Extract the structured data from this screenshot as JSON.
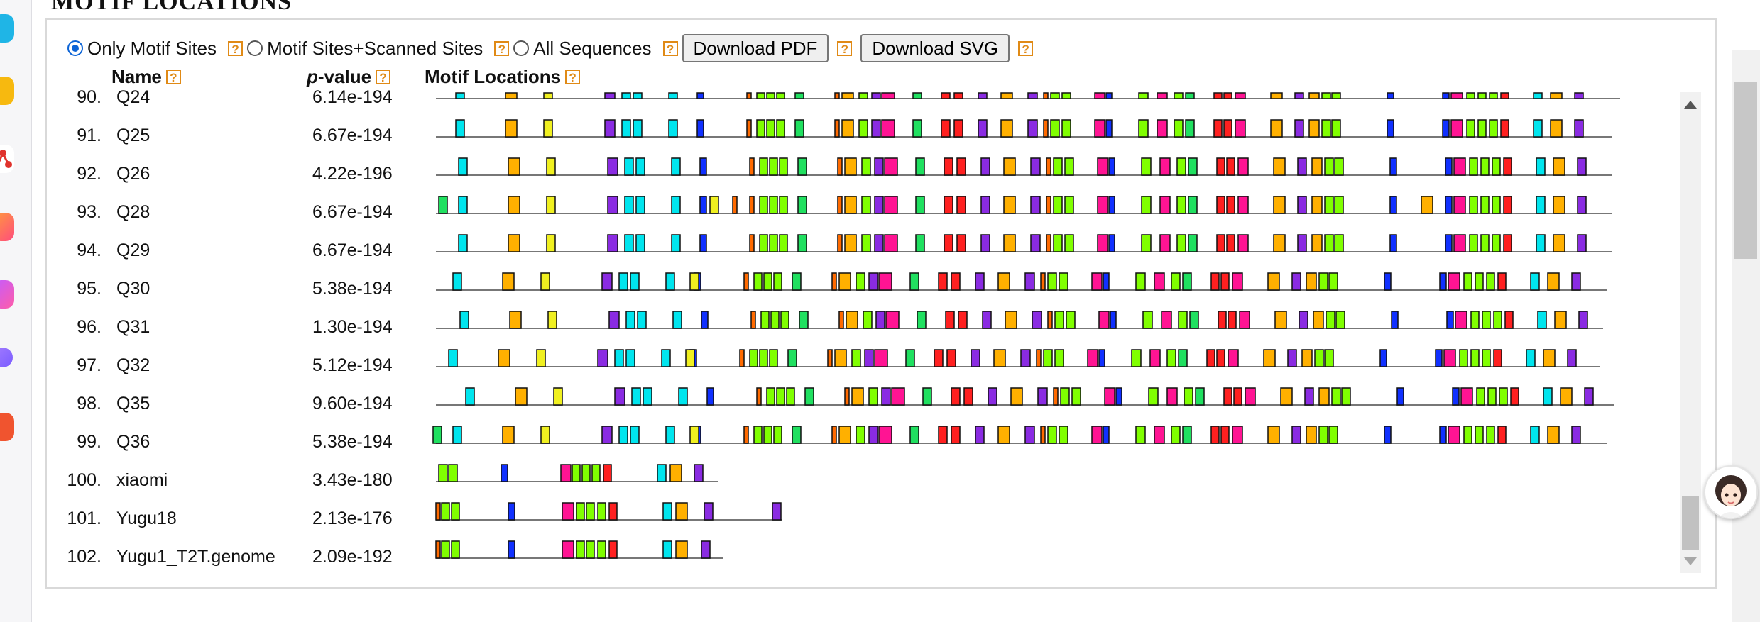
{
  "section": {
    "title": "MOTIF LOCATIONS"
  },
  "toolbar": {
    "options": [
      {
        "label": "Only Motif Sites",
        "selected": true
      },
      {
        "label": "Motif Sites+Scanned Sites",
        "selected": false
      },
      {
        "label": "All Sequences",
        "selected": false
      }
    ],
    "download_pdf": "Download PDF",
    "download_svg": "Download SVG",
    "help_glyph": "?"
  },
  "columns": {
    "name": "Name",
    "pvalue_p": "p",
    "pvalue_rest": "-value",
    "locations": "Motif Locations"
  },
  "rows": [
    {
      "num": "90.",
      "name": "Q24",
      "pvalue": "6.14e-194"
    },
    {
      "num": "91.",
      "name": "Q25",
      "pvalue": "6.67e-194"
    },
    {
      "num": "92.",
      "name": "Q26",
      "pvalue": "4.22e-196"
    },
    {
      "num": "93.",
      "name": "Q28",
      "pvalue": "6.67e-194"
    },
    {
      "num": "94.",
      "name": "Q29",
      "pvalue": "6.67e-194"
    },
    {
      "num": "95.",
      "name": "Q30",
      "pvalue": "5.38e-194"
    },
    {
      "num": "96.",
      "name": "Q31",
      "pvalue": "1.30e-194"
    },
    {
      "num": "97.",
      "name": "Q32",
      "pvalue": "5.12e-194"
    },
    {
      "num": "98.",
      "name": "Q35",
      "pvalue": "9.60e-194"
    },
    {
      "num": "99.",
      "name": "Q36",
      "pvalue": "5.38e-194"
    },
    {
      "num": "100.",
      "name": "xiaomi",
      "pvalue": "3.43e-180"
    },
    {
      "num": "101.",
      "name": "Yugu18",
      "pvalue": "2.13e-176"
    },
    {
      "num": "102.",
      "name": "Yugu1_T2T.genome",
      "pvalue": "2.09e-192"
    }
  ],
  "colors": {
    "help_orange": "#e08a16",
    "radio_blue": "#0b63d6",
    "motif_palette": [
      "#00e5ee",
      "#ffb000",
      "#f0f020",
      "#8a2be2",
      "#1030ff",
      "#ff1493",
      "#80ff00",
      "#ff2020",
      "#ff6a00",
      "#20e060"
    ]
  },
  "icons": [
    "radio-icon",
    "help-icon",
    "scroll-up-icon",
    "scroll-down-icon",
    "assistant-avatar-icon"
  ]
}
